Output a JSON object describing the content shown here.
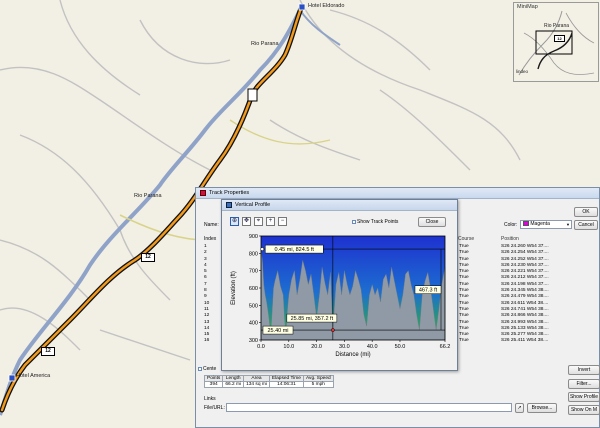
{
  "map": {
    "labels": {
      "hotel_eldorado": "Hotel Eldorado",
      "rio_parana_north": "Rio Parana",
      "rio_parana_south": "Rio Parana",
      "hotel_america": "Hotel America"
    },
    "route_shields": [
      "12",
      "12"
    ],
    "colors": {
      "land": "#f2efe4",
      "river": "#8fa3c9",
      "roads": "#c4c4c4",
      "route_outer": "#000000",
      "route_inner": "#f39a1c",
      "highway": "#d9d38a"
    }
  },
  "minimap": {
    "title": "MiniMap",
    "label": "Rio Parana",
    "shield": "12",
    "corner_label": "lindeo"
  },
  "track_properties": {
    "title": "Track Properties",
    "name_label": "Name:",
    "color_label": "Color:",
    "color_value": "Magenta",
    "color_swatch": "#e000e0",
    "ok_label": "OK",
    "cancel_label": "Cancel",
    "columns": {
      "index": "Index",
      "course": "Course",
      "position": "Position"
    },
    "rows": [
      {
        "index": "1",
        "course": "True",
        "position": "S26 24.260 W54 37...."
      },
      {
        "index": "2",
        "course": "True",
        "position": "S26 24.254 W54 37...."
      },
      {
        "index": "3",
        "course": "True",
        "position": "S26 24.252 W54 37...."
      },
      {
        "index": "4",
        "course": "True",
        "position": "S26 24.230 W54 37...."
      },
      {
        "index": "5",
        "course": "True",
        "position": "S26 24.221 W54 37...."
      },
      {
        "index": "6",
        "course": "True",
        "position": "S26 24.212 W54 37...."
      },
      {
        "index": "7",
        "course": "True",
        "position": "S26 24.198 W54 37...."
      },
      {
        "index": "8",
        "course": "True",
        "position": "S26 24.345 W54 38...."
      },
      {
        "index": "9",
        "course": "True",
        "position": "S26 24.479 W54 38...."
      },
      {
        "index": "10",
        "course": "True",
        "position": "S26 24.611 W54 38...."
      },
      {
        "index": "11",
        "course": "True",
        "position": "S26 24.741 W54 38...."
      },
      {
        "index": "12",
        "course": "True",
        "position": "S26 24.866 W54 38...."
      },
      {
        "index": "13",
        "course": "True",
        "position": "S26 24.993 W54 38...."
      },
      {
        "index": "14",
        "course": "True",
        "position": "S26 25.133 W54 38...."
      },
      {
        "index": "15",
        "course": "True",
        "position": "S26 25.277 W54 38...."
      },
      {
        "index": "16",
        "course": "True",
        "position": "S26 25.411 W54 38...."
      }
    ],
    "center_label": "Cente",
    "invert_label": "Invert",
    "filter_label": "Filter...",
    "show_profile_label": "Show Profile",
    "show_on_map_label": "Show On M",
    "links_label": "Links",
    "file_url_label": "File/URL:",
    "browse_label": "Browse...",
    "stats": {
      "headers": [
        "Points",
        "Length",
        "Area",
        "Elapsed Time",
        "Avg. Speed"
      ],
      "values": [
        "394",
        "66.2 mi",
        "134 sq mi",
        "14:06:31",
        "5 mph"
      ]
    }
  },
  "vertical_profile": {
    "title": "Vertical Profile",
    "show_track_points_label": "Show Track Points",
    "close_label": "Close",
    "toolbar_icons": [
      "select-icon",
      "pan-icon",
      "measure-icon",
      "zoom-in-icon",
      "zoom-out-icon"
    ]
  },
  "chart_data": {
    "type": "area",
    "title": "",
    "xlabel": "Distance  (mi)",
    "ylabel": "Elevation (ft)",
    "xlim": [
      0,
      66.2
    ],
    "ylim": [
      300,
      900
    ],
    "x_ticks": [
      "0.0",
      "10.0",
      "20.0",
      "30.0",
      "40.0",
      "50.0",
      "66.2"
    ],
    "x_tick_values": [
      0,
      10,
      20,
      30,
      40,
      50,
      66.2
    ],
    "y_ticks": [
      "900",
      "800",
      "700",
      "600",
      "500",
      "400",
      "300"
    ],
    "y_tick_values": [
      900,
      800,
      700,
      600,
      500,
      400,
      300
    ],
    "grid": false,
    "colors": {
      "sky_top": "#1e31d0",
      "sky_bottom": "#2dba2d",
      "terrain": "#8f9aa6",
      "annotation": "#000000"
    },
    "x": [
      0,
      0.5,
      1,
      1.5,
      2,
      2.5,
      3,
      3.5,
      4,
      4.5,
      5,
      6,
      7,
      8,
      8.5,
      9,
      9.5,
      10,
      11,
      12,
      13,
      14,
      15,
      16,
      17,
      18,
      19,
      20,
      21,
      22,
      23,
      24,
      25,
      25.85,
      27,
      28,
      29,
      30,
      31,
      32,
      33,
      34,
      35,
      36,
      37,
      38,
      39,
      40,
      41,
      42,
      43,
      44,
      45,
      46,
      47,
      48,
      49,
      50,
      51,
      52,
      53,
      54,
      55,
      56,
      57,
      58,
      59,
      60,
      61,
      62,
      63,
      64,
      65,
      66.2
    ],
    "y": [
      824.5,
      760,
      620,
      560,
      520,
      470,
      410,
      330,
      460,
      600,
      640,
      700,
      610,
      560,
      420,
      330,
      470,
      560,
      650,
      700,
      560,
      650,
      760,
      700,
      620,
      680,
      560,
      430,
      560,
      720,
      630,
      560,
      690,
      357.2,
      620,
      690,
      560,
      700,
      620,
      560,
      610,
      700,
      650,
      590,
      450,
      380,
      560,
      620,
      560,
      600,
      520,
      650,
      680,
      600,
      720,
      640,
      560,
      480,
      560,
      680,
      700,
      620,
      560,
      450,
      360,
      560,
      640,
      690,
      600,
      480,
      360,
      480,
      620,
      720
    ],
    "annotations": [
      {
        "text": "0.45 mi, 824.5 ft",
        "x": 0.45,
        "y": 824.5
      },
      {
        "text": "25.85 mi, 357.2 ft",
        "x": 25.85,
        "y": 357.2
      },
      {
        "text": "25.40 mi",
        "x": 25.4,
        "y": 357.2
      },
      {
        "text": "467.3 ft",
        "x": 66.2,
        "y": 590
      }
    ]
  }
}
